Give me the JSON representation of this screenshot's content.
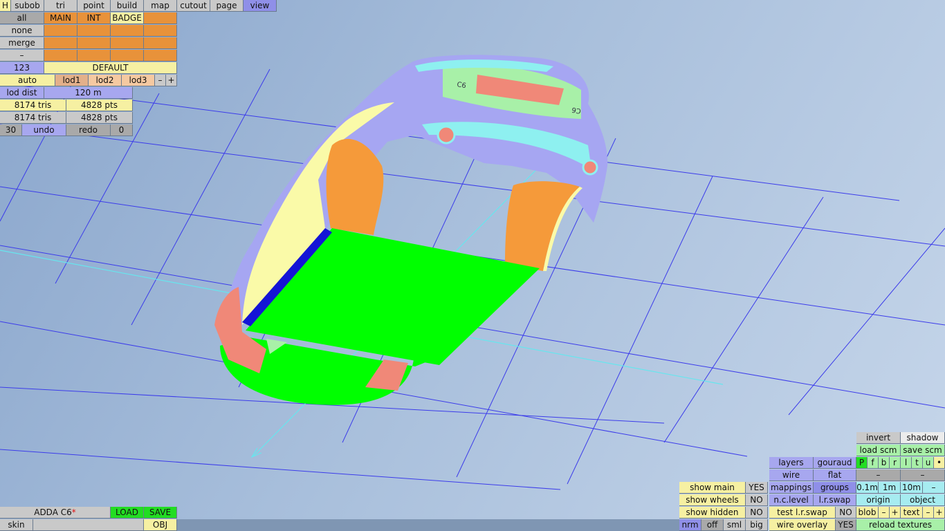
{
  "menu": {
    "h": "H",
    "items": [
      "subob",
      "tri",
      "point",
      "build",
      "map",
      "cutout",
      "page",
      "view"
    ]
  },
  "left_panel": {
    "all": "all",
    "none": "none",
    "merge": "merge",
    "minus": "–",
    "layer_main": "MAIN",
    "layer_int": "INT",
    "layer_badge": "BADGE",
    "num": "123",
    "default": "DEFAULT",
    "auto": "auto",
    "lod1": "lod1",
    "lod2": "lod2",
    "lod3": "lod3",
    "lod_minus": "–",
    "lod_plus": "+",
    "lod_dist_label": "lod dist",
    "lod_dist_value": "120 m",
    "tris1": "8174 tris",
    "pts1": "4828 pts",
    "tris2": "8174 tris",
    "pts2": "4828 pts",
    "undo_count": "30",
    "undo": "undo",
    "redo": "redo",
    "redo_count": "0"
  },
  "file_panel": {
    "name": "ADDA C6",
    "modified_mark": "*",
    "load": "LOAD",
    "save": "SAVE",
    "skin": "skin",
    "obj": "OBJ"
  },
  "view_panel": {
    "invert": "invert",
    "shadow": "shadow",
    "load_scm": "load scm",
    "save_scm": "save scm",
    "axes": [
      "P",
      "f",
      "b",
      "r",
      "l",
      "t",
      "u",
      "•"
    ],
    "layers": "layers",
    "gouraud": "gouraud",
    "wire": "wire",
    "flat": "flat",
    "dash1": "–",
    "dash2": "–",
    "mappings": "mappings",
    "groups": "groups",
    "grid_01": "0.1m",
    "grid_1": "1m",
    "grid_10": "10m",
    "grid_minus": "–",
    "show_main": "show main",
    "show_main_val": "YES",
    "show_wheels": "show wheels",
    "show_wheels_val": "NO",
    "show_hidden": "show hidden",
    "show_hidden_val": "NO",
    "nc_level": "n.c.level",
    "lr_swap": "l.r.swap",
    "origin": "origin",
    "object": "object",
    "test_lr_swap": "test l.r.swap",
    "test_lr_swap_val": "NO",
    "blob": "blob",
    "blob_minus": "–",
    "blob_plus": "+",
    "text": "text",
    "text_minus": "–",
    "text_plus": "+",
    "nrm": "nrm",
    "off": "off",
    "sml": "sml",
    "big": "big",
    "wire_overlay": "wire overlay",
    "wire_overlay_val": "YES",
    "reload_textures": "reload textures"
  },
  "model": {
    "badge_text": "C6"
  },
  "colors": {
    "grid_line": "#3b3bea",
    "axis_line": "#66e6ee",
    "underbody": "#00ff00",
    "body_lavender": "#a6a6f2",
    "body_yellow": "#fafaa8",
    "wheel_arch": "#f59a3a",
    "salmon": "#f08878",
    "cyan_trim": "#8ef0f0",
    "sill_blue": "#1414d6"
  }
}
